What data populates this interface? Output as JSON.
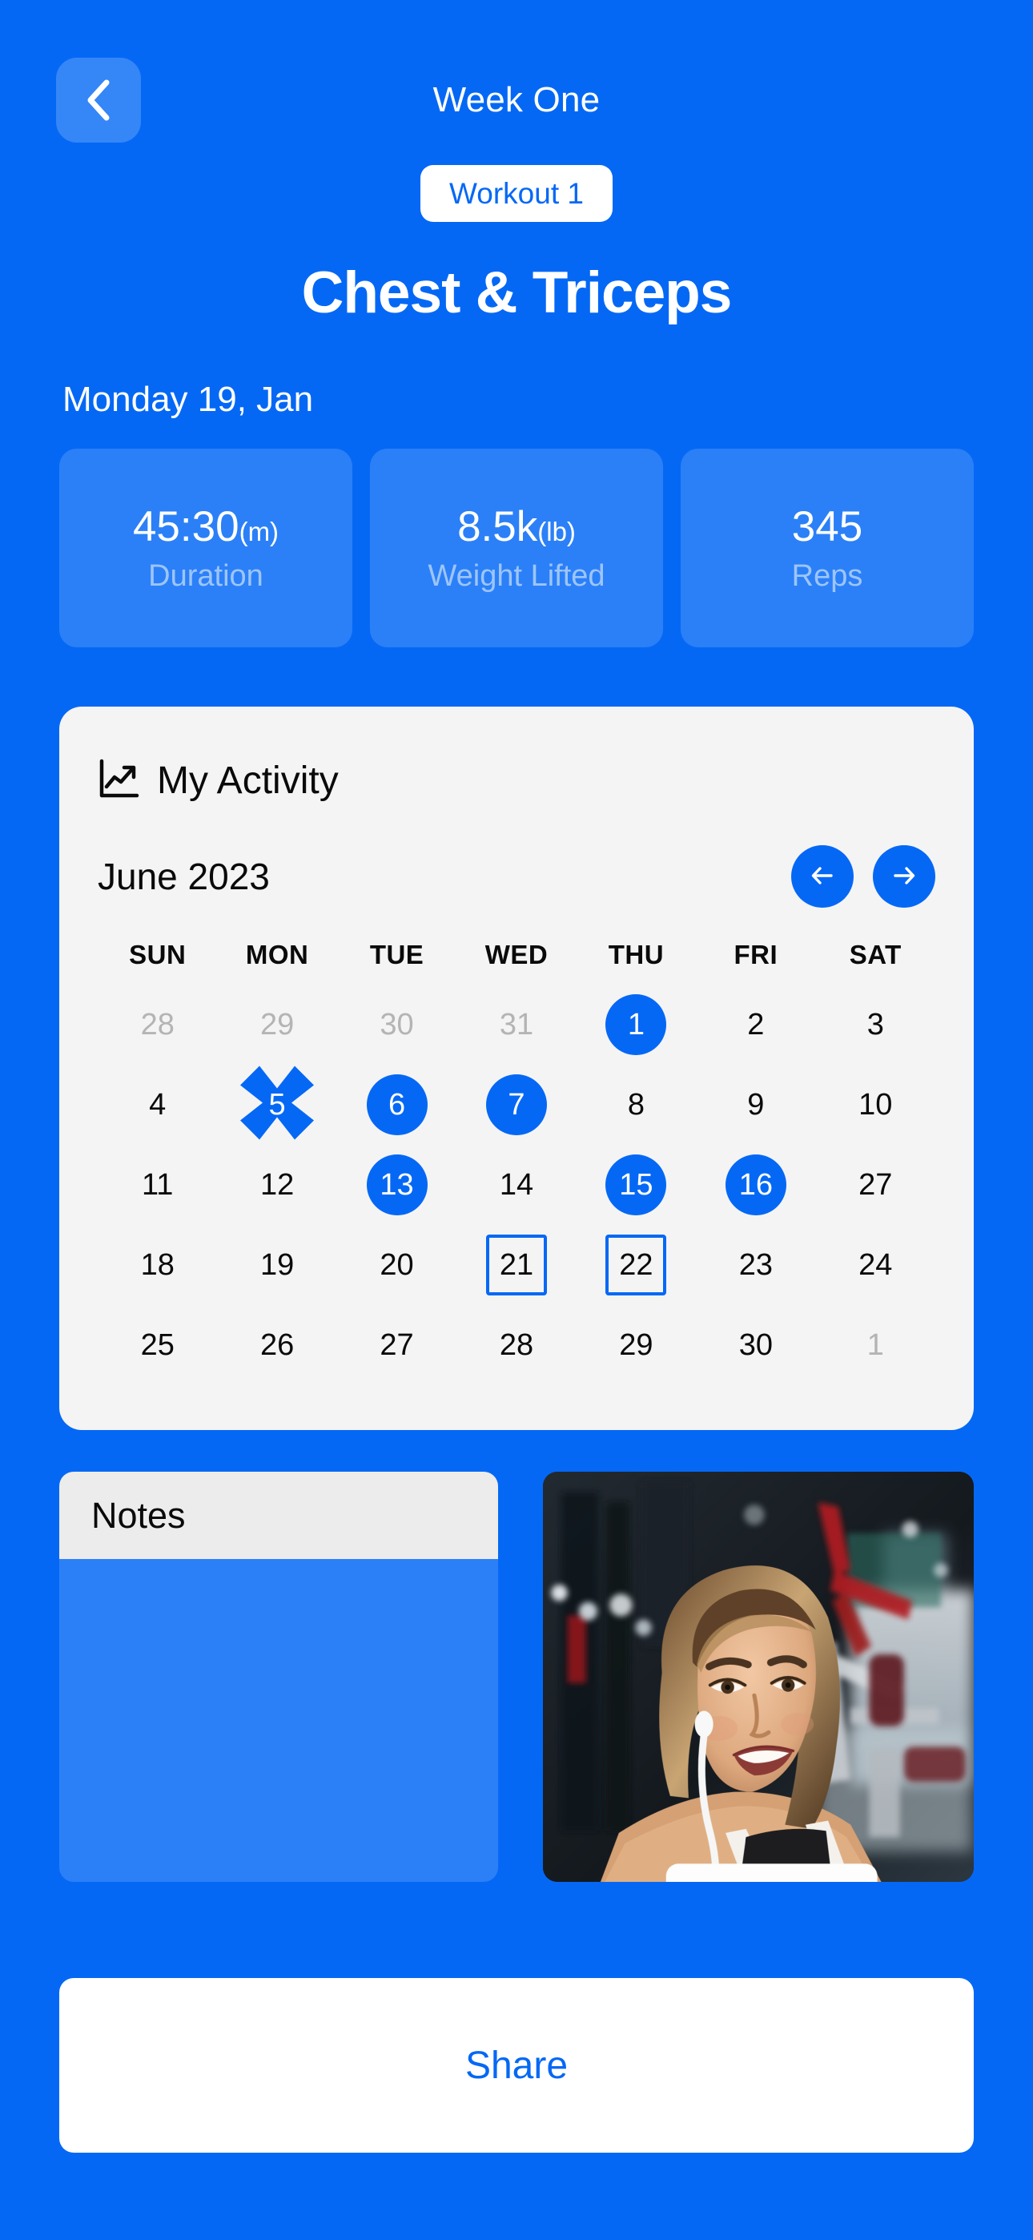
{
  "theme": {
    "brand_blue": "#0568f5",
    "card_blue": "#2b80f7",
    "light_gray": "#f4f4f4",
    "notes_header_gray": "#ececec",
    "muted_text": "#b4b4b4",
    "stat_label": "#9dc5fb"
  },
  "header": {
    "back_icon": "chevron-left-icon",
    "title": "Week One",
    "workout_badge": "Workout 1",
    "workout_title": "Chest & Triceps"
  },
  "session": {
    "date": "Monday 19, Jan",
    "stats": [
      {
        "value": "45:30",
        "unit": "(m)",
        "label": "Duration"
      },
      {
        "value": "8.5k",
        "unit": "(lb)",
        "label": "Weight Lifted"
      },
      {
        "value": "345",
        "unit": "",
        "label": "Reps"
      }
    ]
  },
  "activity": {
    "icon": "trending-up-chart-icon",
    "title": "My Activity",
    "month_label": "June 2023",
    "prev_icon": "arrow-left-icon",
    "next_icon": "arrow-right-icon",
    "weekdays": [
      "SUN",
      "MON",
      "TUE",
      "WED",
      "THU",
      "FRI",
      "SAT"
    ],
    "weeks": [
      [
        {
          "day": "28",
          "state": "muted"
        },
        {
          "day": "29",
          "state": "muted"
        },
        {
          "day": "30",
          "state": "muted"
        },
        {
          "day": "31",
          "state": "muted"
        },
        {
          "day": "1",
          "state": "filled"
        },
        {
          "day": "2",
          "state": "normal"
        },
        {
          "day": "3",
          "state": "normal"
        }
      ],
      [
        {
          "day": "4",
          "state": "normal"
        },
        {
          "day": "5",
          "state": "crossed"
        },
        {
          "day": "6",
          "state": "filled"
        },
        {
          "day": "7",
          "state": "filled"
        },
        {
          "day": "8",
          "state": "normal"
        },
        {
          "day": "9",
          "state": "normal"
        },
        {
          "day": "10",
          "state": "normal"
        }
      ],
      [
        {
          "day": "11",
          "state": "normal"
        },
        {
          "day": "12",
          "state": "normal"
        },
        {
          "day": "13",
          "state": "filled"
        },
        {
          "day": "14",
          "state": "normal"
        },
        {
          "day": "15",
          "state": "filled"
        },
        {
          "day": "16",
          "state": "filled"
        },
        {
          "day": "27",
          "state": "normal"
        }
      ],
      [
        {
          "day": "18",
          "state": "normal"
        },
        {
          "day": "19",
          "state": "normal"
        },
        {
          "day": "20",
          "state": "normal"
        },
        {
          "day": "21",
          "state": "outlined"
        },
        {
          "day": "22",
          "state": "outlined"
        },
        {
          "day": "23",
          "state": "normal"
        },
        {
          "day": "24",
          "state": "normal"
        }
      ],
      [
        {
          "day": "25",
          "state": "normal"
        },
        {
          "day": "26",
          "state": "normal"
        },
        {
          "day": "27",
          "state": "normal"
        },
        {
          "day": "28",
          "state": "normal"
        },
        {
          "day": "29",
          "state": "normal"
        },
        {
          "day": "30",
          "state": "normal"
        },
        {
          "day": "1",
          "state": "muted"
        }
      ]
    ]
  },
  "notes": {
    "title": "Notes",
    "value": ""
  },
  "photo": {
    "alt": "smiling woman with earphones in a gym"
  },
  "footer": {
    "share_label": "Share"
  }
}
